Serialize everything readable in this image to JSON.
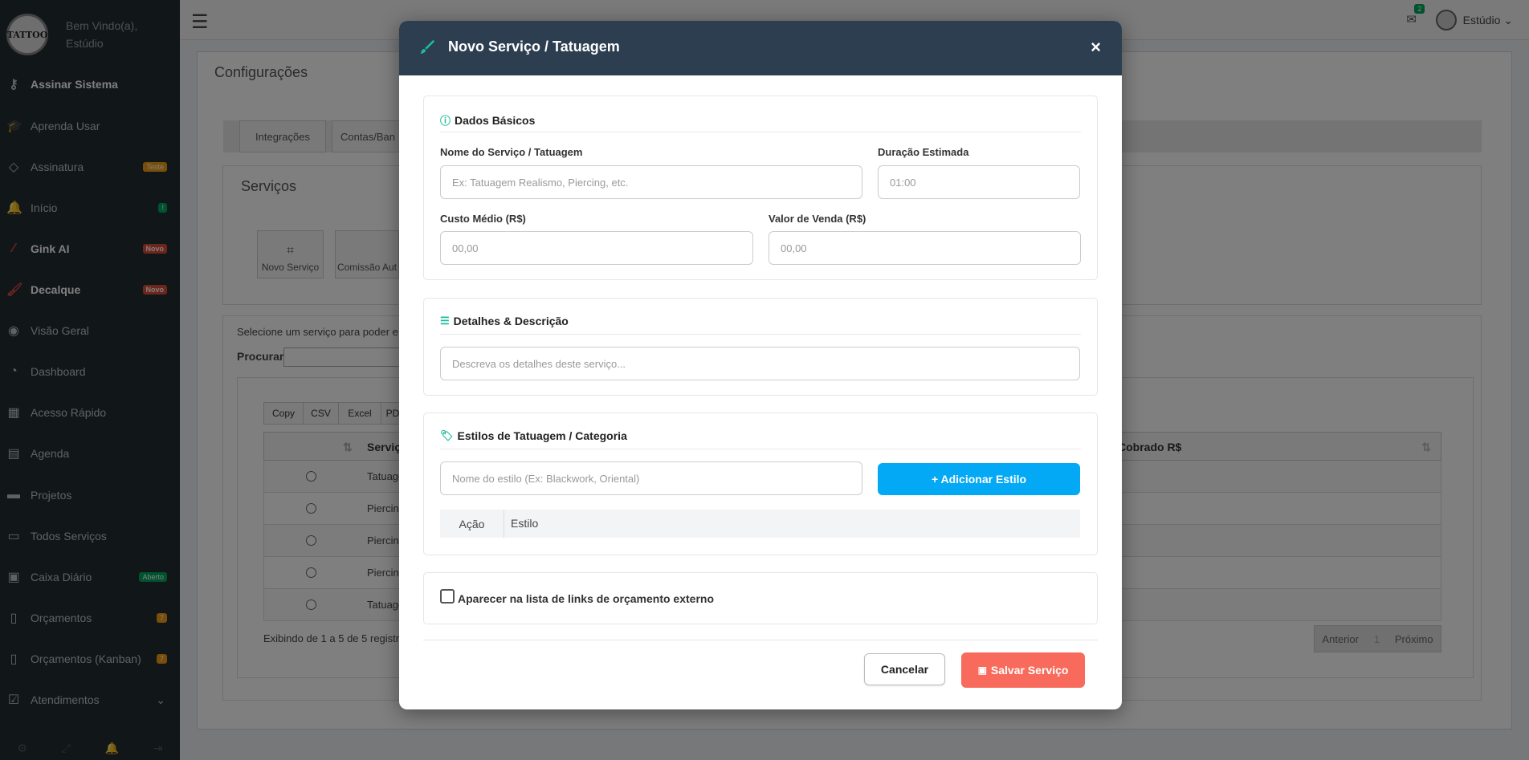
{
  "sidebar": {
    "welcome_line1": "Bem Vindo(a),",
    "welcome_line2": "Estúdio",
    "logo_text": "TATTOO",
    "items": [
      {
        "label": "Assinar Sistema",
        "icon": "key-icon",
        "badge": ""
      },
      {
        "label": "Aprenda Usar",
        "icon": "graduation-cap-icon",
        "badge": ""
      },
      {
        "label": "Assinatura",
        "icon": "diamond-icon",
        "badge": "Teste"
      },
      {
        "label": "Início",
        "icon": "bell-icon",
        "badge": "!"
      },
      {
        "label": "Gink AI",
        "icon": "magic-wand-icon",
        "badge": "Novo"
      },
      {
        "label": "Decalque",
        "icon": "brush-icon",
        "badge": "Novo"
      },
      {
        "label": "Visão Geral",
        "icon": "eye-icon",
        "badge": ""
      },
      {
        "label": "Dashboard",
        "icon": "dashboard-icon",
        "badge": ""
      },
      {
        "label": "Acesso Rápido",
        "icon": "grid-icon",
        "badge": ""
      },
      {
        "label": "Agenda",
        "icon": "calendar-icon",
        "badge": ""
      },
      {
        "label": "Projetos",
        "icon": "folder-icon",
        "badge": ""
      },
      {
        "label": "Todos Serviços",
        "icon": "folder-open-icon",
        "badge": ""
      },
      {
        "label": "Caixa Diário",
        "icon": "money-icon",
        "badge": "Aberto"
      },
      {
        "label": "Orçamentos",
        "icon": "file-icon",
        "badge": "7"
      },
      {
        "label": "Orçamentos (Kanban)",
        "icon": "file-icon",
        "badge": "7"
      },
      {
        "label": "Atendimentos",
        "icon": "check-square-icon",
        "badge": ""
      }
    ]
  },
  "topbar": {
    "notification_count": "2",
    "user_label": "Estúdio ⌄"
  },
  "background": {
    "config_title": "Configurações",
    "tabs": [
      "Integrações",
      "Contas/Ban"
    ],
    "servicos_title": "Serviços",
    "buttons": [
      "Novo Serviço",
      "Comissão Aut"
    ],
    "select_text": "Selecione um serviço para poder e",
    "procurar_label": "Procurar",
    "export_buttons": [
      "Copy",
      "CSV",
      "Excel",
      "PD"
    ],
    "table_header_servico": "Serviço",
    "table_header_cobrado": "Cobrado R$",
    "rows": [
      "Tatuage",
      "Piercin",
      "Piercin",
      "Piercin",
      "Tatuage"
    ],
    "showing_text": "Exibindo de 1 a 5 de 5 registr",
    "pager": {
      "prev": "Anterior",
      "page": "1",
      "next": "Próximo"
    }
  },
  "modal": {
    "title": "Novo Serviço / Tatuagem",
    "close": "×",
    "basic": {
      "title": "Dados Básicos",
      "name_label": "Nome do Serviço / Tatuagem",
      "name_placeholder": "Ex: Tatuagem Realismo, Piercing, etc.",
      "duration_label": "Duração Estimada",
      "duration_value": "01:00",
      "cost_label": "Custo Médio (R$)",
      "cost_value": "00,00",
      "price_label": "Valor de Venda (R$)",
      "price_value": "00,00"
    },
    "details": {
      "title": "Detalhes & Descrição",
      "placeholder": "Descreva os detalhes deste serviço..."
    },
    "styles": {
      "title": "Estilos de Tatuagem / Categoria",
      "input_placeholder": "Nome do estilo (Ex: Blackwork, Oriental)",
      "add_button": "+ Adicionar Estilo",
      "col_action": "Ação",
      "col_style": "Estilo"
    },
    "external": {
      "label": "Aparecer na lista de links de orçamento externo"
    },
    "cancel_button": "Cancelar",
    "save_button": "Salvar Serviço"
  },
  "colors": {
    "modal_header": "#2c3e50",
    "accent_teal": "#1abc9c",
    "add_button": "#03a9f4",
    "save_button": "#f86b5c",
    "sidebar": "#222d32"
  }
}
